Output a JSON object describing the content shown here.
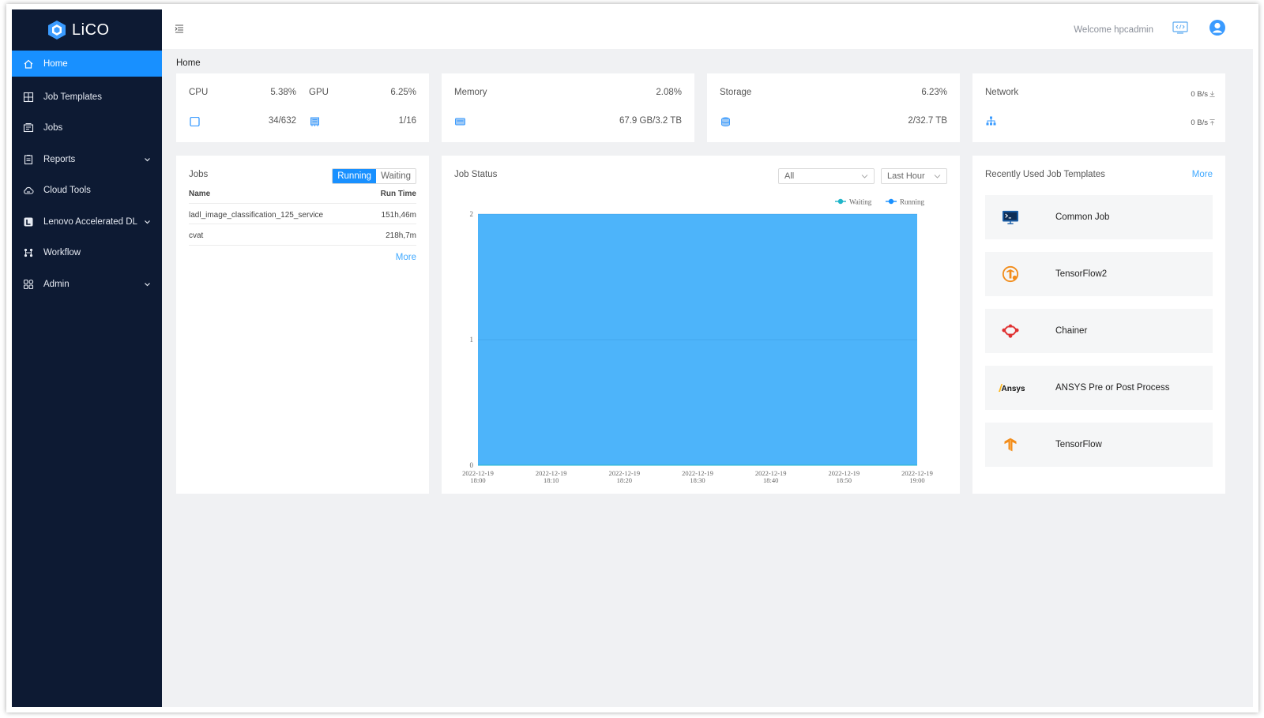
{
  "app": {
    "name": "LiCO"
  },
  "header": {
    "welcome": "Welcome hpcadmin"
  },
  "sidebar": {
    "items": [
      {
        "label": "Home",
        "icon": "home-icon",
        "active": true
      },
      {
        "label": "Job Templates",
        "icon": "template-icon"
      },
      {
        "label": "Jobs",
        "icon": "jobs-icon"
      },
      {
        "label": "Reports",
        "icon": "report-icon",
        "expandable": true
      },
      {
        "label": "Cloud Tools",
        "icon": "cloud-tools-icon"
      },
      {
        "label": "Lenovo Accelerated DL",
        "icon": "lenovo-dl-icon",
        "expandable": true
      },
      {
        "label": "Workflow",
        "icon": "workflow-icon"
      },
      {
        "label": "Admin",
        "icon": "admin-icon",
        "expandable": true
      }
    ]
  },
  "breadcrumb": "Home",
  "stats": {
    "cpu": {
      "label": "CPU",
      "percent": "5.38%",
      "detail": "34/632"
    },
    "gpu": {
      "label": "GPU",
      "percent": "6.25%",
      "detail": "1/16"
    },
    "memory": {
      "label": "Memory",
      "percent": "2.08%",
      "detail": "67.9 GB/3.2 TB"
    },
    "storage": {
      "label": "Storage",
      "percent": "6.23%",
      "detail": "2/32.7 TB"
    },
    "network": {
      "label": "Network",
      "download": "0 B/s",
      "upload": "0 B/s"
    }
  },
  "jobs": {
    "title": "Jobs",
    "tabs": [
      "Running",
      "Waiting"
    ],
    "active_tab": "Running",
    "columns": [
      "Name",
      "Run Time"
    ],
    "rows": [
      {
        "name": "ladl_image_classification_125_service",
        "runtime": "151h,46m"
      },
      {
        "name": "cvat",
        "runtime": "218h,7m"
      }
    ],
    "more": "More"
  },
  "job_status": {
    "title": "Job Status",
    "filter_queue": "All",
    "filter_time": "Last Hour"
  },
  "chart_data": {
    "type": "area",
    "legend_position": "top-right",
    "x": [
      "2022-12-19 18:00",
      "2022-12-19 18:10",
      "2022-12-19 18:20",
      "2022-12-19 18:30",
      "2022-12-19 18:40",
      "2022-12-19 18:50",
      "2022-12-19 19:00"
    ],
    "x_ticks": [
      [
        "2022-12-19",
        "18:00"
      ],
      [
        "2022-12-19",
        "18:10"
      ],
      [
        "2022-12-19",
        "18:20"
      ],
      [
        "2022-12-19",
        "18:30"
      ],
      [
        "2022-12-19",
        "18:40"
      ],
      [
        "2022-12-19",
        "18:50"
      ],
      [
        "2022-12-19",
        "19:00"
      ]
    ],
    "y_ticks": [
      "0",
      "1",
      "2"
    ],
    "ylim": [
      0,
      2
    ],
    "series": [
      {
        "name": "Waiting",
        "color": "#1fb5c9",
        "values": [
          0,
          0,
          0,
          0,
          0,
          0,
          0
        ]
      },
      {
        "name": "Running",
        "color": "#1890ff",
        "values": [
          2,
          2,
          2,
          2,
          2,
          2,
          2
        ]
      }
    ]
  },
  "templates": {
    "title": "Recently Used Job Templates",
    "more": "More",
    "items": [
      {
        "name": "Common Job",
        "icon": "terminal-icon"
      },
      {
        "name": "TensorFlow2",
        "icon": "tensorflow2-icon"
      },
      {
        "name": "Chainer",
        "icon": "chainer-icon"
      },
      {
        "name": "ANSYS Pre or Post Process",
        "icon": "ansys-logo",
        "logo_text": "Ansys"
      },
      {
        "name": "TensorFlow",
        "icon": "tensorflow-icon"
      }
    ]
  },
  "colors": {
    "sidebar_bg": "#0d1a33",
    "accent": "#1890ff",
    "area_fill": "#4db4fa"
  }
}
